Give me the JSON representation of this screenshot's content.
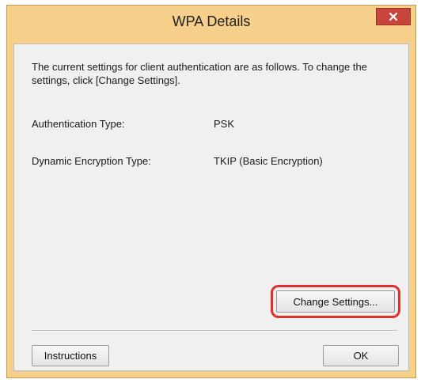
{
  "window": {
    "title": "WPA Details"
  },
  "dialog": {
    "intro_text": "The current settings for client authentication are as follows. To change the settings, click [Change Settings].",
    "auth_type_label": "Authentication Type:",
    "auth_type_value": "PSK",
    "encryption_type_label": "Dynamic Encryption Type:",
    "encryption_type_value": "TKIP (Basic Encryption)"
  },
  "buttons": {
    "change_settings": "Change Settings...",
    "instructions": "Instructions",
    "ok": "OK"
  },
  "icons": {
    "close": "close-icon"
  },
  "colors": {
    "title_bar": "#f6d08a",
    "close_button": "#c7463c",
    "highlight": "#e0302a"
  }
}
